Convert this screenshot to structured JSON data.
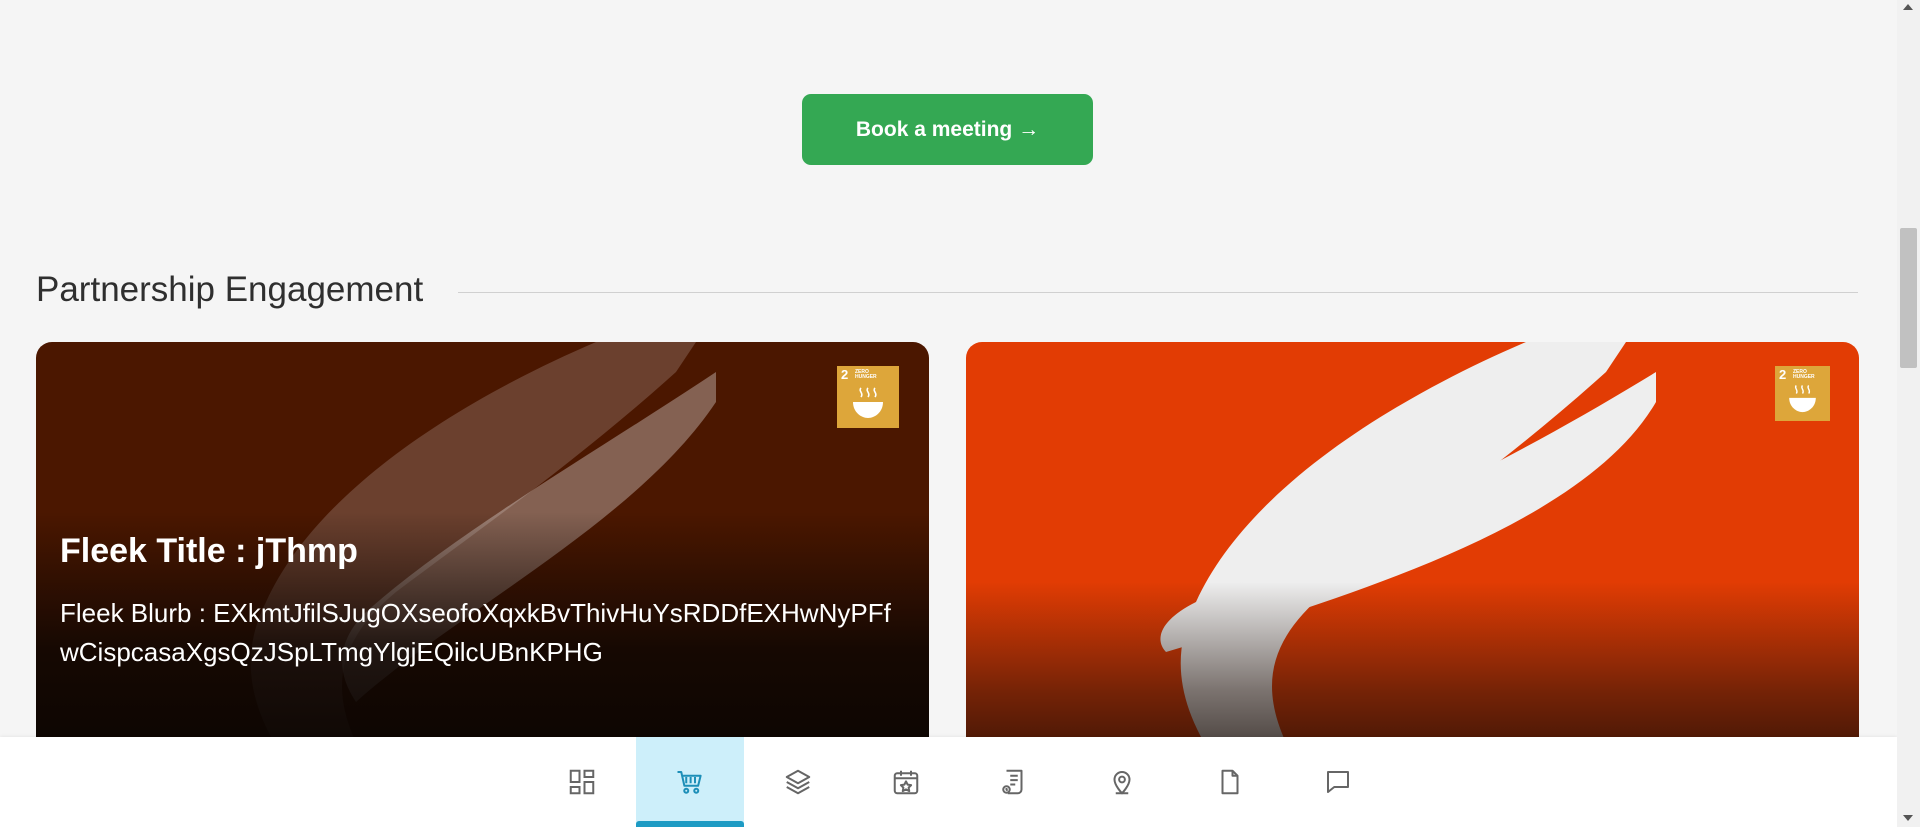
{
  "cta": {
    "label": "Book a meeting →"
  },
  "section": {
    "title": "Partnership Engagement"
  },
  "cards": [
    {
      "title": "Fleek Title : jThmp",
      "blurb": "Fleek Blurb : EXkmtJfilSJugOXseofoXqxkBvThivHuYsRDDfEXHwNyPFfwCispcasaXgsQzJSpLTmgYlgjEQilcUBnKPHG",
      "badge": {
        "number": "2",
        "text": "ZERO HUNGER"
      }
    },
    {
      "title": "",
      "blurb": "",
      "badge": {
        "number": "2",
        "text": "ZERO HUNGER"
      }
    }
  ],
  "bottom_nav": {
    "active_index": 1,
    "items": [
      {
        "icon": "dashboard-icon"
      },
      {
        "icon": "cart-icon"
      },
      {
        "icon": "layers-icon"
      },
      {
        "icon": "calendar-star-icon"
      },
      {
        "icon": "receipt-icon"
      },
      {
        "icon": "location-pin-icon"
      },
      {
        "icon": "document-icon"
      },
      {
        "icon": "chat-icon"
      }
    ]
  },
  "colors": {
    "cta": "#34a853",
    "active_nav_bg": "#cdeffa",
    "active_nav_indicator": "#1d9bc4",
    "card_dark": "#4b1700",
    "card_orange": "#e23c04",
    "sdg_badge": "#dda63a"
  }
}
